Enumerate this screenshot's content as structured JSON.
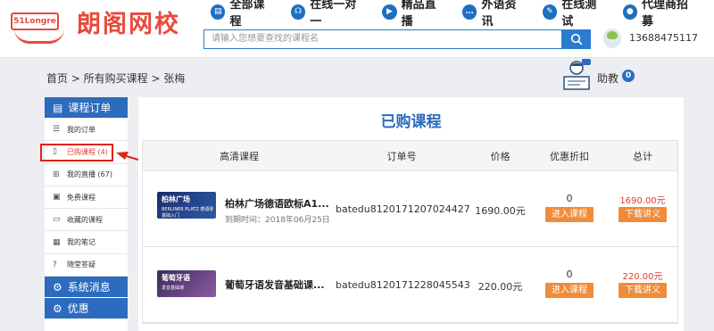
{
  "logo": {
    "badge": "51Longre",
    "name": "朗阁网校"
  },
  "nav": [
    {
      "label": "全部课程",
      "icon": "book-icon"
    },
    {
      "label": "在线一对一",
      "icon": "headset-icon"
    },
    {
      "label": "精品直播",
      "icon": "live-icon"
    },
    {
      "label": "外语资讯",
      "icon": "chat-icon"
    },
    {
      "label": "在线测试",
      "icon": "edit-icon"
    },
    {
      "label": "代理商招募",
      "icon": "user-icon"
    }
  ],
  "search": {
    "placeholder": "请输入您想要查找的课程名"
  },
  "user": {
    "phone": "13688475117"
  },
  "breadcrumb": "首页 > 所有购买课程 > 张梅",
  "assistant": {
    "label": "助教",
    "count": "0"
  },
  "sidebar": {
    "section1": "课程订单",
    "items": [
      {
        "label": "我的订单",
        "icon": "list-icon"
      },
      {
        "label": "已购课程 (4)",
        "icon": "book-icon"
      },
      {
        "label": "我的直播 (67)",
        "icon": "plus-icon"
      },
      {
        "label": "免费课程",
        "icon": "gift-icon"
      },
      {
        "label": "收藏的课程",
        "icon": "folder-icon"
      },
      {
        "label": "我的笔记",
        "icon": "note-icon"
      },
      {
        "label": "随堂答疑",
        "icon": "question-icon"
      }
    ],
    "section2": "系统消息",
    "section3": "优惠"
  },
  "main": {
    "title": "已购课程",
    "headers": [
      "高清课程",
      "订单号",
      "价格",
      "优惠折扣",
      "总计"
    ],
    "rows": [
      {
        "thumb_title": "柏林广场",
        "thumb_sub": "BERLINER PLATZ 德语零基础入门",
        "name": "柏林广场德语欧标A1...",
        "expiry": "到期时间：2018年06月25日",
        "order": "batedu8120171207024427",
        "price": "1690.00元",
        "discount": "0",
        "total": "1690.00元",
        "enter": "进入课程",
        "download": "下载讲义"
      },
      {
        "thumb_title": "葡萄牙语",
        "thumb_sub": "发音基础课",
        "name": "葡萄牙语发音基础课...",
        "expiry": "",
        "order": "batedu8120171228045543",
        "price": "220.00元",
        "discount": "0",
        "total": "220.00元",
        "enter": "进入课程",
        "download": "下载讲义"
      }
    ]
  },
  "colors": {
    "brand_red": "#e84a3c",
    "primary_blue": "#2c6bbd",
    "orange": "#f08b3a",
    "highlight_red": "#e0231b"
  }
}
